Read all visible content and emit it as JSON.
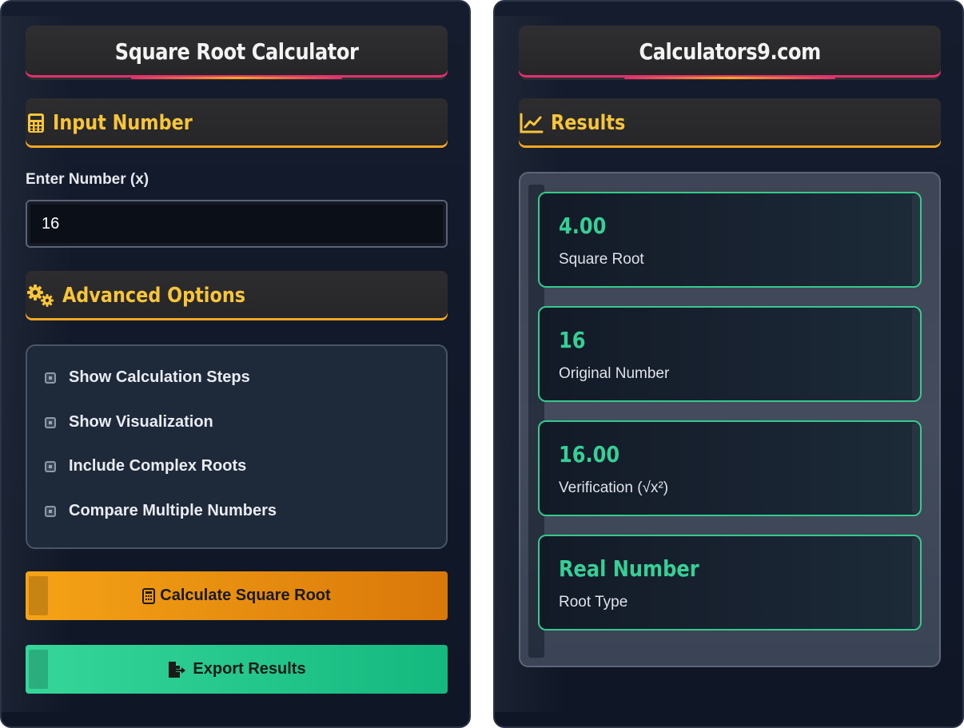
{
  "left": {
    "title": "Square Root Calculator",
    "input_section": {
      "title": "Input Number",
      "icon": "calculator-icon"
    },
    "input": {
      "label": "Enter Number (x)",
      "value": "16"
    },
    "advanced_section": {
      "title": "Advanced Options",
      "icon": "gears-icon"
    },
    "options": [
      {
        "label": "Show Calculation Steps",
        "checked": false
      },
      {
        "label": "Show Visualization",
        "checked": false
      },
      {
        "label": "Include Complex Roots",
        "checked": false
      },
      {
        "label": "Compare Multiple Numbers",
        "checked": false
      }
    ],
    "buttons": {
      "calculate": "Calculate Square Root",
      "export": "Export Results"
    }
  },
  "right": {
    "title": "Calculators9.com",
    "results_section": {
      "title": "Results",
      "icon": "chart-line-icon"
    },
    "results": [
      {
        "value": "4.00",
        "caption": "Square Root"
      },
      {
        "value": "16",
        "caption": "Original Number"
      },
      {
        "value": "16.00",
        "caption": "Verification (√x²)"
      },
      {
        "value": "Real Number",
        "caption": "Root Type"
      }
    ]
  },
  "colors": {
    "accent_yellow": "#f8c53a",
    "accent_orange": "#f5a316",
    "accent_green": "#36d097",
    "accent_pink": "#e0306f",
    "panel_bg": "#141c2d"
  }
}
